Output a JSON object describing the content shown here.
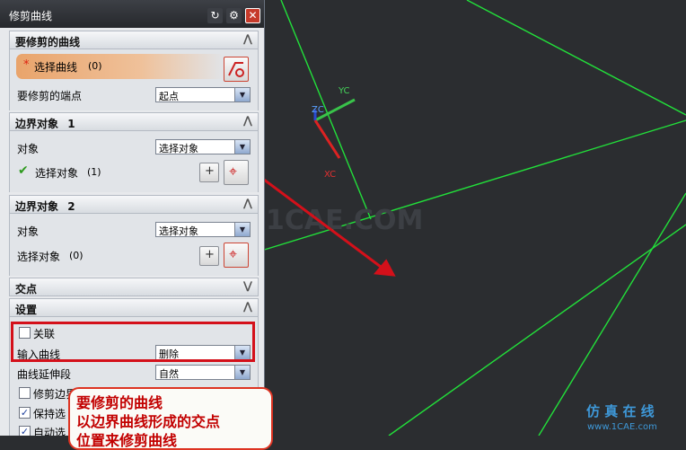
{
  "dialog": {
    "title": "修剪曲线",
    "sections": {
      "curve_to_trim": {
        "header": "要修剪的曲线",
        "select_curve_label": "选择曲线",
        "select_curve_count": "(0)",
        "endpoint_label": "要修剪的端点",
        "endpoint_value": "起点"
      },
      "boundary1": {
        "header": "边界对象",
        "header_num": "1",
        "object_label": "对象",
        "object_value": "选择对象",
        "select_label": "选择对象",
        "select_count": "(1)"
      },
      "boundary2": {
        "header": "边界对象",
        "header_num": "2",
        "object_label": "对象",
        "object_value": "选择对象",
        "select_label": "选择对象",
        "select_count": "(0)"
      },
      "intersection": {
        "header": "交点"
      },
      "settings": {
        "header": "设置",
        "associative_label": "关联",
        "input_curve_label": "输入曲线",
        "input_curve_value": "删除",
        "curve_extension_label": "曲线延伸段",
        "curve_extension_value": "自然",
        "trim_boundary_label": "修剪边界",
        "keep_selected_label": "保持选",
        "auto_select_label": "自动选"
      }
    }
  },
  "axes": {
    "zc": "ZC",
    "yc": "YC",
    "xc": "XC"
  },
  "watermark": "1CAE.COM",
  "callout": {
    "line1": "要修剪的曲线",
    "line2": "以边界曲线形成的交点",
    "line3": "位置来修剪曲线"
  },
  "logo": {
    "line1": "仿 真 在 线",
    "line2": "www.1CAE.com"
  },
  "colors": {
    "viewport_bg": "#2b2d30",
    "curve_green": "#22e03a",
    "arrow_red": "#d4101a",
    "dialog_bg": "#e7e9ec"
  }
}
